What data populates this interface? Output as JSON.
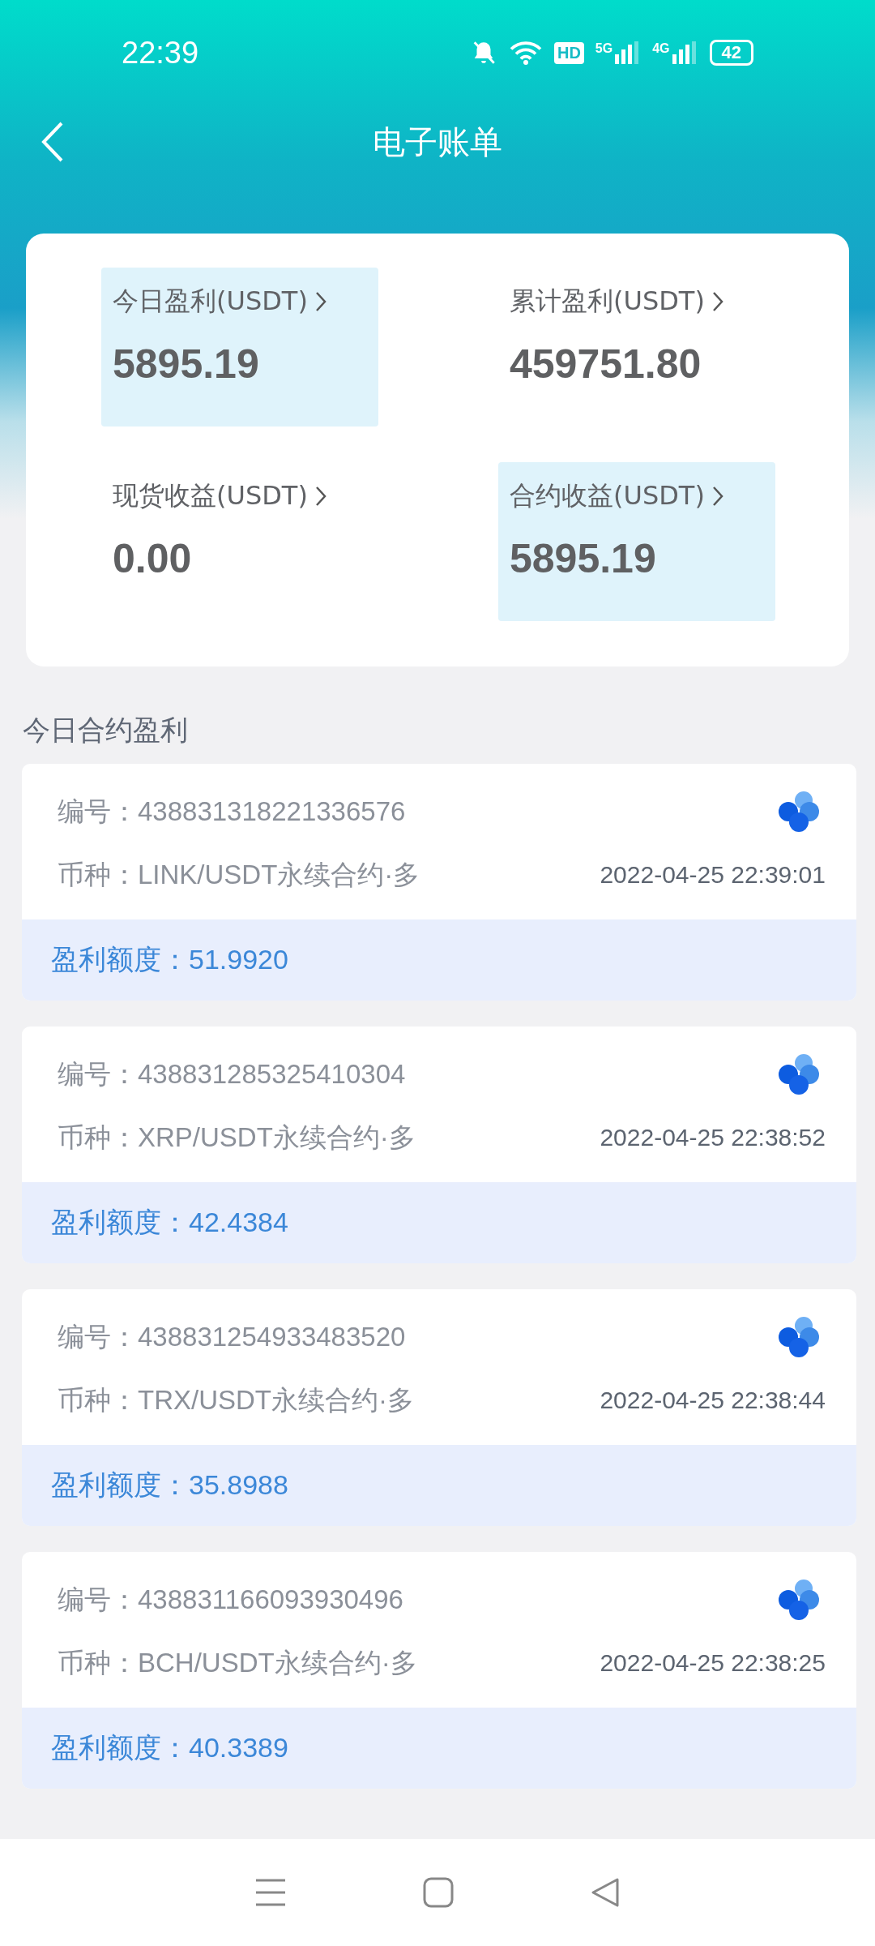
{
  "status_bar": {
    "time": "22:39",
    "hd_label": "HD",
    "networks": [
      "5G",
      "4G"
    ],
    "battery": "42"
  },
  "header": {
    "title": "电子账单"
  },
  "summary": [
    {
      "label": "今日盈利(USDT)",
      "value": "5895.19",
      "highlighted": true
    },
    {
      "label": "累计盈利(USDT)",
      "value": "459751.80",
      "highlighted": false
    },
    {
      "label": "现货收益(USDT)",
      "value": "0.00",
      "highlighted": false
    },
    {
      "label": "合约收益(USDT)",
      "value": "5895.19",
      "highlighted": true
    }
  ],
  "section_title": "今日合约盈利",
  "records": [
    {
      "id_label": "编号：",
      "id": "438831318221336576",
      "coin_label": "币种：",
      "coin": "LINK/USDT永续合约·多",
      "time": "2022-04-25 22:39:01",
      "profit_label": "盈利额度：",
      "profit": "51.9920"
    },
    {
      "id_label": "编号：",
      "id": "438831285325410304",
      "coin_label": "币种：",
      "coin": "XRP/USDT永续合约·多",
      "time": "2022-04-25 22:38:52",
      "profit_label": "盈利额度：",
      "profit": "42.4384"
    },
    {
      "id_label": "编号：",
      "id": "438831254933483520",
      "coin_label": "币种：",
      "coin": "TRX/USDT永续合约·多",
      "time": "2022-04-25 22:38:44",
      "profit_label": "盈利额度：",
      "profit": "35.8988"
    },
    {
      "id_label": "编号：",
      "id": "438831166093930496",
      "coin_label": "币种：",
      "coin": "BCH/USDT永续合约·多",
      "time": "2022-04-25 22:38:25",
      "profit_label": "盈利额度：",
      "profit": "40.3389"
    }
  ]
}
